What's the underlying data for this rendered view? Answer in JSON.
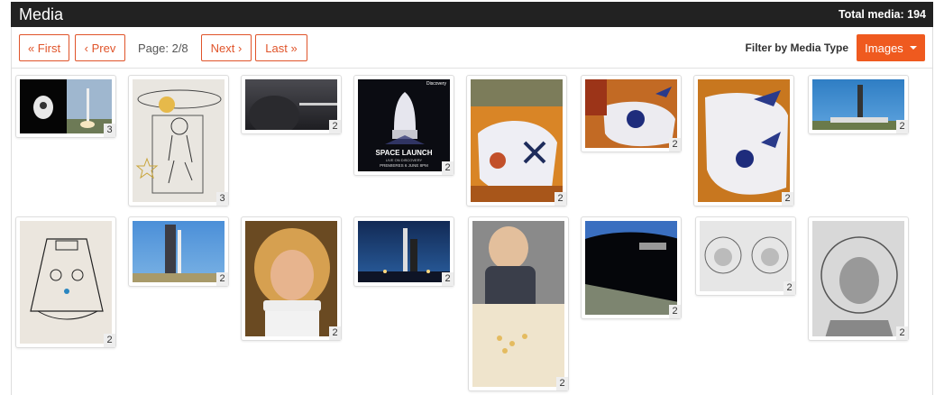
{
  "header": {
    "title": "Media",
    "total": "Total media: 194"
  },
  "pager": {
    "first_label": "« First",
    "prev_label": "‹ Prev",
    "page_label": "Page: 2/8",
    "next_label": "Next ›",
    "last_label": "Last »"
  },
  "filter": {
    "label": "Filter by Media Type",
    "selected": "Images"
  },
  "tiles": [
    {
      "count": "3",
      "desc": "dragon-capsule-launch"
    },
    {
      "count": "3",
      "desc": "astronaut-drawing"
    },
    {
      "count": "2",
      "desc": "capsule-dark"
    },
    {
      "count": "2",
      "desc": "space-launch-poster",
      "poster_brand": "Discovery",
      "poster_title": "SPACE LAUNCH",
      "poster_sub": "LIVE ON DISCOVERY",
      "poster_date": "PREMIERES 6 JUNE 8PM"
    },
    {
      "count": "2",
      "desc": "rocket-cast"
    },
    {
      "count": "2",
      "desc": "nasa-f9-cast"
    },
    {
      "count": "2",
      "desc": "nasa-f9-cast-2"
    },
    {
      "count": "2",
      "desc": "launch-pad-day"
    },
    {
      "count": "2",
      "desc": "capsule-sketch"
    },
    {
      "count": "2",
      "desc": "launch-tower-blue"
    },
    {
      "count": "2",
      "desc": "child-helmet"
    },
    {
      "count": "2",
      "desc": "launch-night"
    },
    {
      "count": "2",
      "desc": "baby-highchair"
    },
    {
      "count": "2",
      "desc": "iss-view"
    },
    {
      "count": "2",
      "desc": "astronauts-sketch"
    },
    {
      "count": "2",
      "desc": "astronaut-portrait"
    }
  ]
}
